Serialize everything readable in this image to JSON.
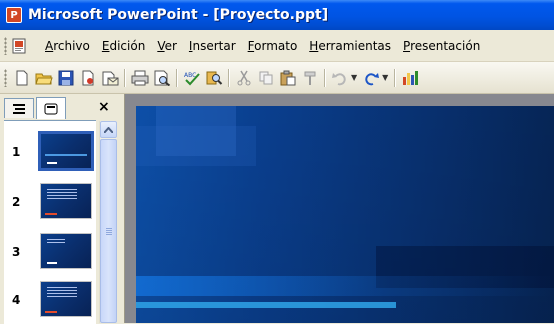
{
  "window": {
    "title": "Microsoft PowerPoint - [Proyecto.ppt]",
    "app_icon_letter": "P"
  },
  "menubar": {
    "items": [
      {
        "label": "Archivo",
        "mnemonic_index": 0
      },
      {
        "label": "Edición",
        "mnemonic_index": 0
      },
      {
        "label": "Ver",
        "mnemonic_index": 0
      },
      {
        "label": "Insertar",
        "mnemonic_index": 0
      },
      {
        "label": "Formato",
        "mnemonic_index": 0
      },
      {
        "label": "Herramientas",
        "mnemonic_index": 0
      },
      {
        "label": "Presentación",
        "mnemonic_index": 0
      }
    ]
  },
  "toolbar": {
    "buttons": [
      "new-icon",
      "open-icon",
      "save-icon",
      "permission-icon",
      "email-icon",
      "print-icon",
      "print-preview-icon",
      "spelling-icon",
      "research-icon",
      "cut-icon",
      "copy-icon",
      "paste-icon",
      "format-painter-icon",
      "undo-icon",
      "redo-icon",
      "chart-icon"
    ]
  },
  "panel": {
    "tabs": [
      "outline-tab-icon",
      "slides-tab-icon"
    ],
    "close_label": "×",
    "slides": [
      {
        "number": "1",
        "selected": true
      },
      {
        "number": "2",
        "selected": false
      },
      {
        "number": "3",
        "selected": false
      },
      {
        "number": "4",
        "selected": false
      }
    ]
  },
  "colors": {
    "titlebar": "#0054e3",
    "selection_border": "#2f5fb8",
    "slide_background": "#0a3f8f"
  }
}
